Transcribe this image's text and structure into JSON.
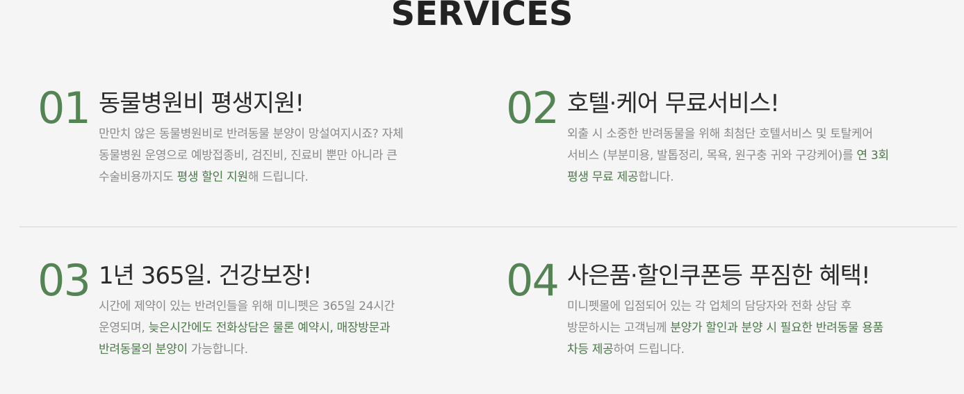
{
  "section": {
    "title": "SERVICES"
  },
  "services": [
    {
      "number": "01",
      "title": "동물병원비 평생지원!",
      "lines": [
        [
          {
            "t": "만만치 않은 동물병원비로 반려동물 분양이 망설여지시죠? 자체",
            "h": false
          }
        ],
        [
          {
            "t": "동물병원 운영으로 예방접종비, 검진비, 진료비 뿐만 아니라 큰",
            "h": false
          }
        ],
        [
          {
            "t": "수술비용까지도 ",
            "h": false
          },
          {
            "t": "평생 할인 지원",
            "h": true
          },
          {
            "t": "해 드립니다.",
            "h": false
          }
        ]
      ]
    },
    {
      "number": "02",
      "title": "호텔·케어 무료서비스!",
      "lines": [
        [
          {
            "t": "외출 시 소중한 반려동물을 위해 최첨단 호텔서비스 및 토탈케어",
            "h": false
          }
        ],
        [
          {
            "t": "서비스 (부분미용, 발톱정리, 목욕, 원구충 귀와 구강케어)를 ",
            "h": false
          },
          {
            "t": "연 3회",
            "h": true
          }
        ],
        [
          {
            "t": "평생 무료 제공",
            "h": true
          },
          {
            "t": "합니다.",
            "h": false
          }
        ]
      ]
    },
    {
      "number": "03",
      "title": "1년 365일. 건강보장!",
      "lines": [
        [
          {
            "t": "시간에 제약이 있는 반려인들을 위해 미니펫은 365일 24시간",
            "h": false
          }
        ],
        [
          {
            "t": "운영되며, ",
            "h": false
          },
          {
            "t": "늦은시간에도 전화상담은 물론 예약시, 매장방문과",
            "h": true
          }
        ],
        [
          {
            "t": "반려동물의 분양이",
            "h": true
          },
          {
            "t": " 가능합니다.",
            "h": false
          }
        ]
      ]
    },
    {
      "number": "04",
      "title": "사은품·할인쿠폰등 푸짐한 혜택!",
      "lines": [
        [
          {
            "t": "미니펫몰에 입점되어 있는 각 업체의 담당자와 전화 상담 후",
            "h": false
          }
        ],
        [
          {
            "t": "방문하시는 고객님께 ",
            "h": false
          },
          {
            "t": "분양가 할인과 분양 시 필요한 반려동물 용품",
            "h": true
          }
        ],
        [
          {
            "t": "차등 제공",
            "h": true
          },
          {
            "t": "하여 드립니다.",
            "h": false
          }
        ]
      ]
    }
  ],
  "colors": {
    "accent": "#558454",
    "highlight": "#4b7a48",
    "text": "#2b2b2b",
    "muted": "#8a8a8a",
    "background": "#f5f5f5"
  }
}
